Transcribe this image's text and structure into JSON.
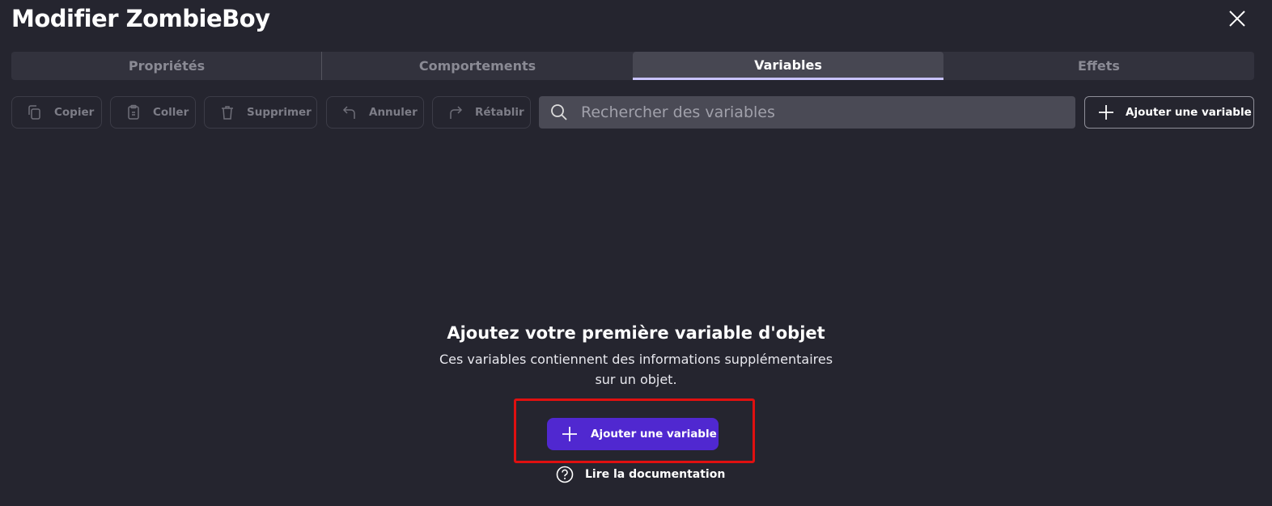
{
  "dialog": {
    "title": "Modifier ZombieBoy"
  },
  "tabs": [
    {
      "label": "Propriétés"
    },
    {
      "label": "Comportements"
    },
    {
      "label": "Variables"
    },
    {
      "label": "Effets"
    }
  ],
  "toolbar": {
    "copy": "Copier",
    "paste": "Coller",
    "delete": "Supprimer",
    "undo": "Annuler",
    "redo": "Rétablir",
    "search_placeholder": "Rechercher des variables",
    "add": "Ajouter une variable"
  },
  "empty_state": {
    "title": "Ajoutez votre première variable d'objet",
    "description": "Ces variables contiennent des informations supplémentaires sur un objet.",
    "add": "Ajouter une variable",
    "doc": "Lire la documentation"
  },
  "colors": {
    "accent": "#5028d0",
    "highlight": "#e01010",
    "background": "#25252f"
  }
}
